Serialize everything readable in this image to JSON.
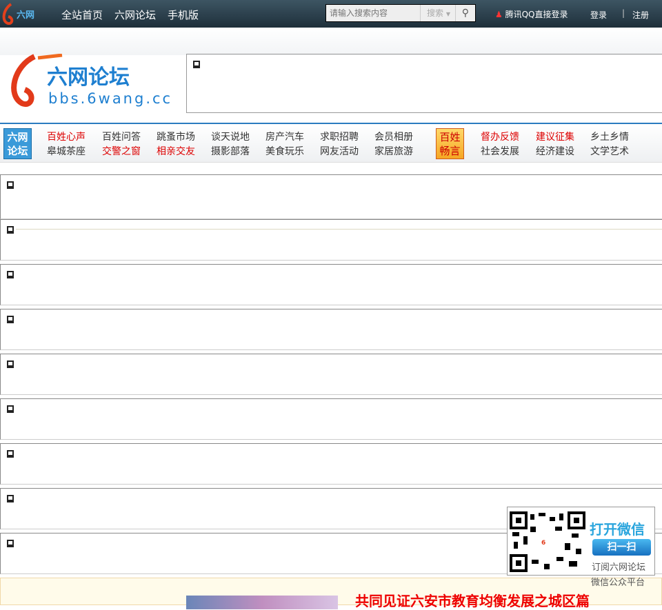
{
  "topbar": {
    "logo_text": "六网",
    "nav": [
      "全站首页",
      "六网论坛",
      "手机版"
    ],
    "search_placeholder": "请输入搜索内容",
    "search_type": "搜索",
    "qq_login": "腾讯QQ直接登录",
    "login": "登录",
    "separator": "|",
    "register": "注册"
  },
  "brand": {
    "title": "六网论坛",
    "domain": "bbs.6wang.cc"
  },
  "navbar": {
    "badge_left": [
      "六网",
      "论坛"
    ],
    "badge_mid": [
      "百姓",
      "畅言"
    ],
    "group1": [
      [
        "百姓心声",
        "皋城茶座"
      ],
      [
        "百姓问答",
        "交警之窗"
      ],
      [
        "跳蚤市场",
        "相亲交友"
      ],
      [
        "谈天说地",
        "摄影部落"
      ],
      [
        "房产汽车",
        "美食玩乐"
      ],
      [
        "求职招聘",
        "网友活动"
      ],
      [
        "会员相册",
        "家居旅游"
      ]
    ],
    "group2": [
      [
        "督办反馈",
        "社会发展"
      ],
      [
        "建议征集",
        "经济建设"
      ],
      [
        "乡土乡情",
        "文学艺术"
      ]
    ]
  },
  "qr": {
    "line1": "打开微信",
    "button": "扫一扫",
    "line2": "订阅六网论坛",
    "line3": "微信公众平台"
  },
  "bottom": {
    "title": "共同见证六安市教育均衡发展之城区篇"
  }
}
